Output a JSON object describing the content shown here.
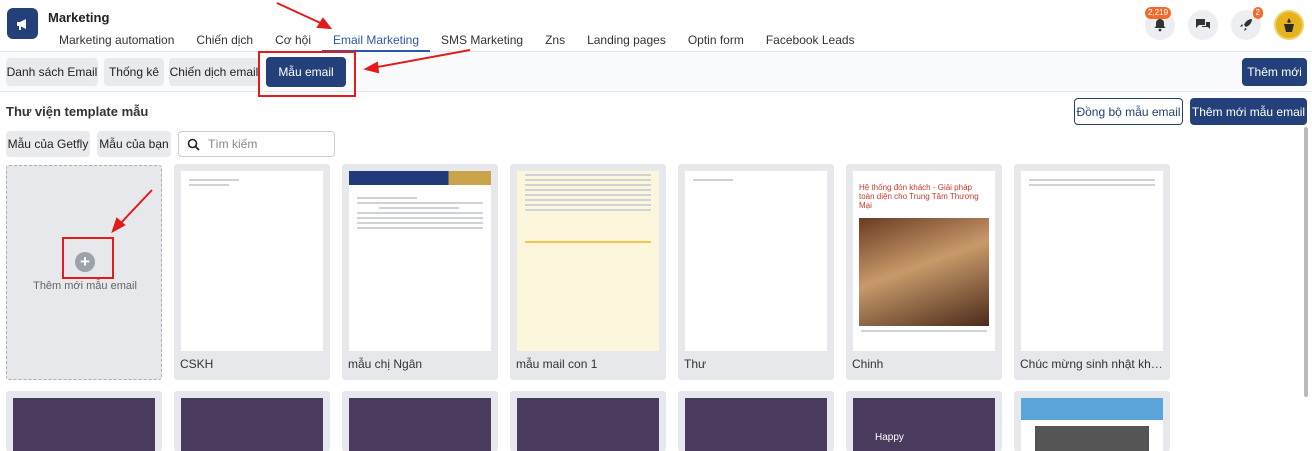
{
  "app": {
    "title": "Marketing"
  },
  "nav": {
    "tabs": [
      "Marketing automation",
      "Chiến dịch",
      "Cơ hội",
      "Email Marketing",
      "SMS Marketing",
      "Zns",
      "Landing pages",
      "Optin form",
      "Facebook Leads"
    ],
    "active": "Email Marketing"
  },
  "header": {
    "notification_count": "2,219",
    "rocket_count": "2"
  },
  "subnav": {
    "email_list": "Danh sách Email",
    "stats": "Thống kê",
    "email_campaign": "Chiến dịch email",
    "email_template": "Mẫu email",
    "add_new": "Thêm mới"
  },
  "library": {
    "title": "Thư viện template mẫu",
    "sync_button": "Đồng bộ mẫu email",
    "add_template_button": "Thêm mới mẫu email",
    "filters": [
      "Mẫu của Getfly",
      "Mẫu của bạn"
    ],
    "search_placeholder": "Tìm kiếm",
    "add_card_label": "Thêm mới mẫu email",
    "templates": [
      "CSKH",
      "mẫu chị Ngân",
      "mẫu mail con 1",
      "Thư",
      "Chinh",
      "Chúc mừng sinh nhật khách ..."
    ],
    "thumb_headline": "Hệ thống đón khách - Giải pháp toàn diện cho Trung Tâm Thương Mại",
    "card_overlay_text": "Happy"
  },
  "colors": {
    "accent": "#24407a",
    "annotation": "#e21b1b"
  }
}
